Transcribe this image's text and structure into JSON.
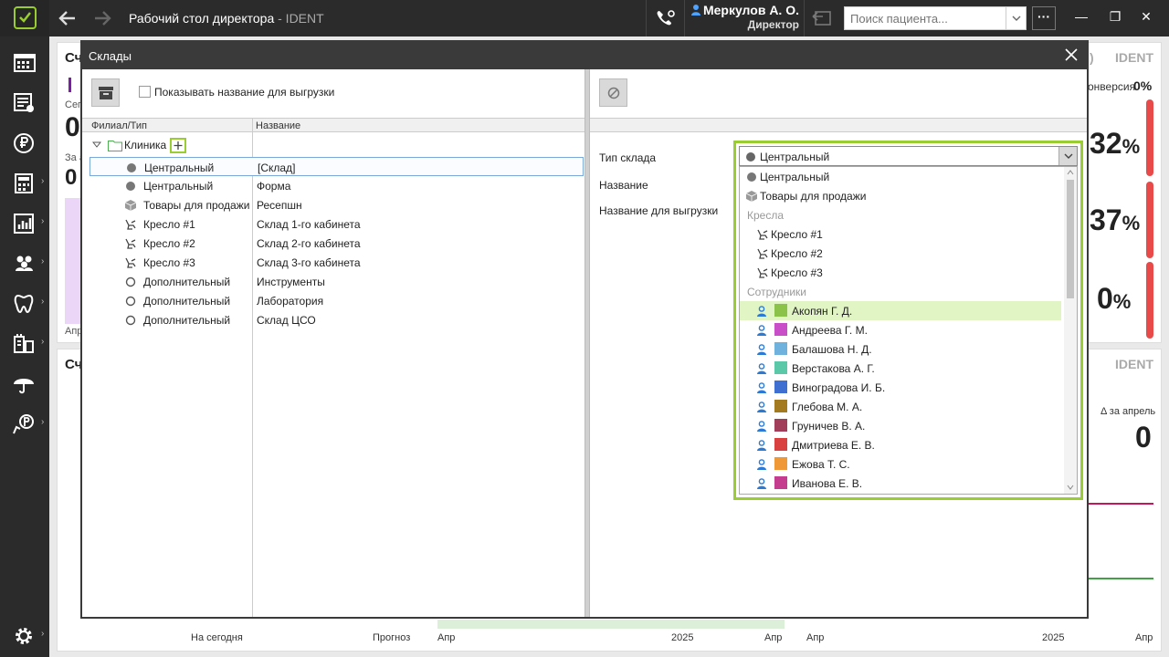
{
  "app": {
    "title": "Рабочий стол директора",
    "title_suffix": "- IDENT",
    "accent": "#9acd32"
  },
  "user": {
    "name": "Меркулов А. О.",
    "role": "Директор"
  },
  "search": {
    "placeholder": "Поиск пациента..."
  },
  "toolbar": {
    "more_label": "···",
    "min": "—",
    "restore": "❐",
    "close": "✕"
  },
  "background": {
    "card1_title": "Сч",
    "card1_sub": "Сег",
    "card1_big": "0",
    "card1_sub2": "За а",
    "card1_big2": "0",
    "card1_axis": "Апр",
    "card2_title": "Сч",
    "ident1": "IDENT",
    "ident1_prefix": ")",
    "conversion_label": "онверсия",
    "conversion_value": "0%",
    "pct1": "32",
    "pct2": "37",
    "pct3": "0",
    "pct_sign": "%",
    "ident2": "IDENT",
    "delta_label": "Δ за апрель",
    "delta_value": "0",
    "bottom_today": "На сегодня",
    "bottom_forecast": "Прогноз",
    "axis_apr1": "Апр",
    "axis_2025a": "2025",
    "axis_apr2": "Апр",
    "axis_apr3": "Апр",
    "axis_2025b": "2025",
    "axis_apr4": "Апр"
  },
  "dialog": {
    "title": "Склады",
    "show_export_name_label": "Показывать название для выгрузки",
    "columns": {
      "branch_type": "Филиал/Тип",
      "name": "Название"
    },
    "root": "Клиника",
    "rows": [
      {
        "type": "Центральный",
        "name": "[Склад]",
        "icon": "dot"
      },
      {
        "type": "Центральный",
        "name": "Форма",
        "icon": "dot"
      },
      {
        "type": "Товары для продажи",
        "name": "Ресепшн",
        "icon": "box"
      },
      {
        "type": "Кресло #1",
        "name": "Склад 1-го кабинета",
        "icon": "chair"
      },
      {
        "type": "Кресло #2",
        "name": "Склад 2-го кабинета",
        "icon": "chair"
      },
      {
        "type": "Кресло #3",
        "name": "Склад 3-го кабинета",
        "icon": "chair"
      },
      {
        "type": "Дополнительный",
        "name": "Инструменты",
        "icon": "ring"
      },
      {
        "type": "Дополнительный",
        "name": "Лаборатория",
        "icon": "ring"
      },
      {
        "type": "Дополнительный",
        "name": "Склад ЦСО",
        "icon": "ring"
      }
    ],
    "fields": {
      "warehouse_type": "Тип склада",
      "name": "Название",
      "export_name": "Название для выгрузки"
    },
    "combo_value": "Центральный",
    "dropdown": [
      {
        "kind": "item",
        "label": "Центральный",
        "icon": "dot"
      },
      {
        "kind": "item",
        "label": "Товары для продажи",
        "icon": "box"
      },
      {
        "kind": "group",
        "label": "Кресла"
      },
      {
        "kind": "chair",
        "label": "Кресло #1"
      },
      {
        "kind": "chair",
        "label": "Кресло #2"
      },
      {
        "kind": "chair",
        "label": "Кресло #3"
      },
      {
        "kind": "group",
        "label": "Сотрудники"
      },
      {
        "kind": "staff",
        "label": "Акопян Г. Д.",
        "color": "#8bc34a",
        "highlight": true
      },
      {
        "kind": "staff",
        "label": "Андреева Г. М.",
        "color": "#c94fc9"
      },
      {
        "kind": "staff",
        "label": "Балашова Н. Д.",
        "color": "#6fb2dd"
      },
      {
        "kind": "staff",
        "label": "Верстакова А. Г.",
        "color": "#5bc9a8"
      },
      {
        "kind": "staff",
        "label": "Виноградова И. Б.",
        "color": "#3f6fd1"
      },
      {
        "kind": "staff",
        "label": "Глебова М. А.",
        "color": "#a37a1f"
      },
      {
        "kind": "staff",
        "label": "Груничев В. А.",
        "color": "#a13f5a"
      },
      {
        "kind": "staff",
        "label": "Дмитриева Е. В.",
        "color": "#d94040"
      },
      {
        "kind": "staff",
        "label": "Ежова Т. С.",
        "color": "#ef9838"
      },
      {
        "kind": "staff",
        "label": "Иванова Е. В.",
        "color": "#c43d8f"
      }
    ]
  }
}
